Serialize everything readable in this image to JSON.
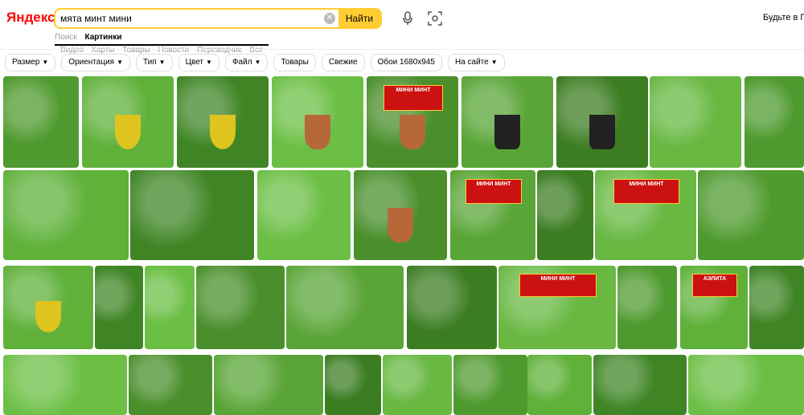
{
  "header": {
    "logo": "Яндекс",
    "search_value": "мята минт мини",
    "find_label": "Найти",
    "promo": "Будьте в Пл"
  },
  "icons": {
    "clear": "close-icon",
    "mic": "microphone-icon",
    "lens": "camera-lens-icon",
    "dropdown": "chevron-down-icon"
  },
  "nav": {
    "items": [
      "Поиск",
      "Картинки",
      "Видео",
      "Карты",
      "Товары",
      "Новости",
      "Переводчик",
      "Все"
    ],
    "active": "Картинки"
  },
  "filters": [
    {
      "label": "Размер",
      "dropdown": true
    },
    {
      "label": "Ориентация",
      "dropdown": true
    },
    {
      "label": "Тип",
      "dropdown": true
    },
    {
      "label": "Цвет",
      "dropdown": true
    },
    {
      "label": "Файл",
      "dropdown": true
    },
    {
      "label": "Товары",
      "dropdown": false
    },
    {
      "label": "Свежие",
      "dropdown": false
    },
    {
      "label": "Обои 1680x945",
      "dropdown": false
    },
    {
      "label": "На сайте",
      "dropdown": true
    }
  ],
  "packet_labels": {
    "mini_mint": "МИНИ МИНТ",
    "avita": "АЭЛИТА"
  },
  "colors": {
    "accent": "#ffcc33",
    "brand_red": "#ff0000",
    "plant_green": "#5ba83a",
    "pot_terracotta": "#b76839"
  }
}
